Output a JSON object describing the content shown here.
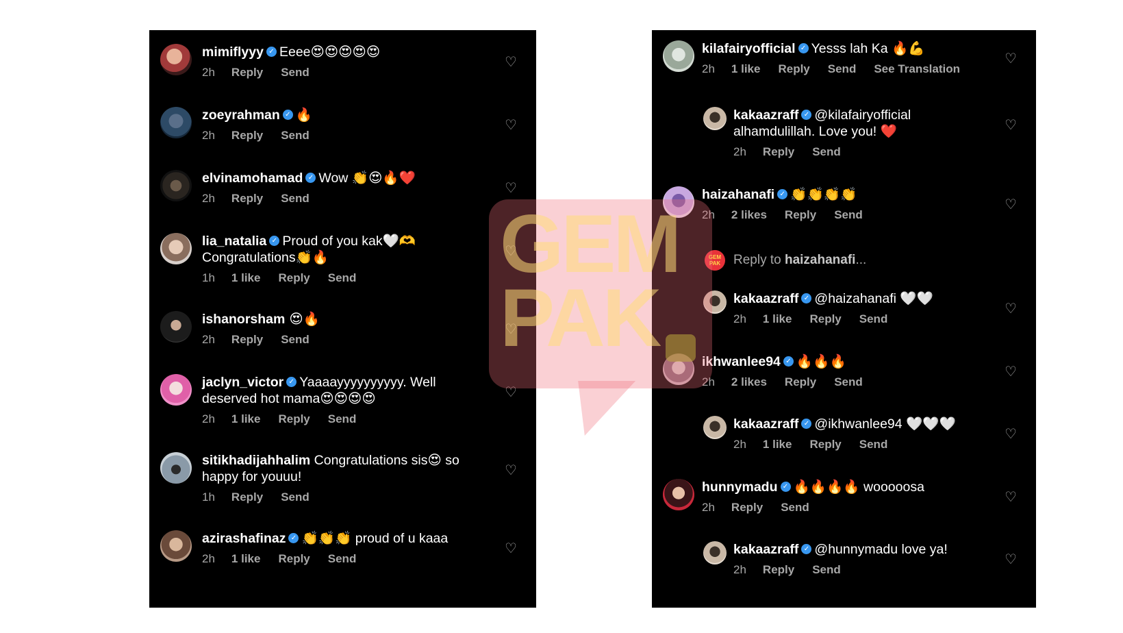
{
  "left_comments": [
    {
      "username": "mimiflyyy",
      "text": "Eeee😍😍😍😍😍",
      "text2": "",
      "meta": [
        "2h",
        "Reply",
        "Send"
      ]
    },
    {
      "username": "zoeyrahman",
      "text": "🔥",
      "text2": "",
      "meta": [
        "2h",
        "Reply",
        "Send"
      ]
    },
    {
      "username": "elvinamohamad",
      "text": "Wow 👏😍🔥❤️",
      "text2": "",
      "meta": [
        "2h",
        "Reply",
        "Send"
      ]
    },
    {
      "username": "lia_natalia",
      "text": "Proud of you kak🤍🫶",
      "text2": "Congratulations👏🔥",
      "meta": [
        "1h",
        "1 like",
        "Reply",
        "Send"
      ]
    },
    {
      "username": "ishanorsham",
      "text": "😍🔥",
      "text2": "",
      "meta": [
        "2h",
        "Reply",
        "Send"
      ]
    },
    {
      "username": "jaclyn_victor",
      "text": "Yaaaayyyyyyyyyy. Well",
      "text2": "deserved hot mama😍😍😍😍",
      "meta": [
        "2h",
        "1 like",
        "Reply",
        "Send"
      ]
    },
    {
      "username": "sitikhadijahhalim",
      "text": "Congratulations sis😍 so",
      "text2": "happy for youuu!",
      "meta": [
        "1h",
        "Reply",
        "Send"
      ]
    },
    {
      "username": "azirashafinaz",
      "text": "👏👏👏 proud of u kaaa",
      "text2": "",
      "meta": [
        "2h",
        "1 like",
        "Reply",
        "Send"
      ]
    }
  ],
  "right_comments": [
    {
      "username": "kilafairyofficial",
      "text": "Yesss lah Ka 🔥💪",
      "text2": "",
      "meta": [
        "2h",
        "1 like",
        "Reply",
        "Send",
        "See Translation"
      ]
    },
    {
      "username": "kakaazraff",
      "text": "@kilafairyofficial",
      "text2": "alhamdulillah. Love you! ❤️",
      "meta": [
        "2h",
        "Reply",
        "Send"
      ]
    },
    {
      "username": "haizahanafi",
      "text": "👏👏👏👏",
      "text2": "",
      "meta": [
        "2h",
        "2 likes",
        "Reply",
        "Send"
      ]
    },
    {
      "username": "kakaazraff",
      "text": "@haizahanafi 🤍🤍",
      "text2": "",
      "meta": [
        "2h",
        "1 like",
        "Reply",
        "Send"
      ]
    },
    {
      "username": "ikhwanlee94",
      "text": "🔥🔥🔥",
      "text2": "",
      "meta": [
        "2h",
        "2 likes",
        "Reply",
        "Send"
      ]
    },
    {
      "username": "kakaazraff",
      "text": "@ikhwanlee94 🤍🤍🤍",
      "text2": "",
      "meta": [
        "2h",
        "1 like",
        "Reply",
        "Send"
      ]
    },
    {
      "username": "hunnymadu",
      "text": "🔥🔥🔥🔥 wooooosa",
      "text2": "",
      "meta": [
        "2h",
        "Reply",
        "Send"
      ]
    },
    {
      "username": "kakaazraff",
      "text": "@hunnymadu love ya!",
      "text2": "",
      "meta": [
        "2h",
        "Reply",
        "Send"
      ]
    }
  ],
  "reply_to": {
    "prefix": "Reply to ",
    "username": "haizahanafi",
    "suffix": "..."
  },
  "mini_logo_text": "GEM PAK",
  "watermark_text": "GEM PAK",
  "icons": {
    "verified": "verified-badge-icon",
    "heart": "heart-outline-icon"
  },
  "colors": {
    "panel_bg": "#000000",
    "text": "#ffffff",
    "meta": "#a8a8a8",
    "verified": "#3897f0",
    "watermark": "#f06e78"
  }
}
